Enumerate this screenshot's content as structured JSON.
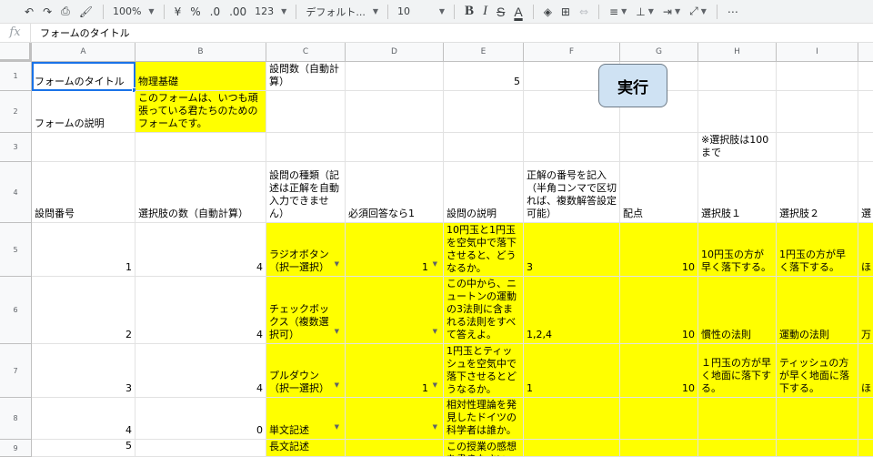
{
  "toolbar": {
    "zoom": "100%",
    "currency": "¥",
    "percent": "%",
    "dec_decrease": ".0",
    "dec_increase": ".00",
    "number_format": "123",
    "font": "デフォルト...",
    "font_size": "10",
    "bold": "B",
    "italic": "I",
    "strike": "S",
    "text_color": "A",
    "more": "⋯"
  },
  "formula_bar": {
    "fx": "fx",
    "value": "フォームのタイトル"
  },
  "columns": [
    "A",
    "B",
    "C",
    "D",
    "E",
    "F",
    "G",
    "H",
    "I"
  ],
  "rows": [
    "1",
    "2",
    "3",
    "4",
    "5",
    "6",
    "7",
    "8",
    "9"
  ],
  "run_button": {
    "label": "実行"
  },
  "cells": {
    "A1": "フォームのタイトル",
    "B1": "物理基礎",
    "C1": "設問数（自動計算）",
    "E1": "5",
    "A2": "フォームの説明",
    "B2": "このフォームは、いつも頑張っている君たちのためのフォームです。",
    "H3": "※選択肢は100まで",
    "A4": "設問番号",
    "B4": "選択肢の数（自動計算）",
    "C4": "設問の種類（記述は正解を自動入力できません）",
    "D4": "必須回答なら1",
    "E4": "設問の説明",
    "F4": "正解の番号を記入（半角コンマで区切れば、複数解答設定可能）",
    "G4": "配点",
    "H4": "選択肢１",
    "I4": "選択肢２",
    "J4": "選",
    "A5": "1",
    "B5": "4",
    "C5": "ラジオボタン（択一選択）",
    "D5": "1",
    "E5": "10円玉と1円玉を空気中で落下させると、どうなるか。",
    "F5": "3",
    "G5": "10",
    "H5": "10円玉の方が早く落下する。",
    "I5": "1円玉の方が早く落下する。",
    "J5": "ほ",
    "A6": "2",
    "B6": "4",
    "C6": "チェックボックス（複数選択可）",
    "E6": "この中から、ニュートンの運動の3法則に含まれる法則をすべて答えよ。",
    "F6": "1,2,4",
    "G6": "10",
    "H6": "慣性の法則",
    "I6": "運動の法則",
    "J6": "万",
    "A7": "3",
    "B7": "4",
    "C7": "プルダウン（択一選択）",
    "D7": "1",
    "E7": "1円玉とティッシュを空気中で落下させるとどうなるか。",
    "F7": "1",
    "G7": "10",
    "H7": "１円玉の方が早く地面に落下する。",
    "I7": "ティッシュの方が早く地面に落下する。",
    "J7": "ほ",
    "A8": "4",
    "B8": "0",
    "C8": "単文記述",
    "E8": "相対性理論を発見したドイツの科学者は誰か。",
    "A9": "5",
    "C9": "長文記述",
    "E9": "この授業の感想を書きなさい"
  },
  "colors": {
    "yellow": "#ffff00",
    "button_bg": "#cfe2f3",
    "selection": "#1a73e8"
  }
}
